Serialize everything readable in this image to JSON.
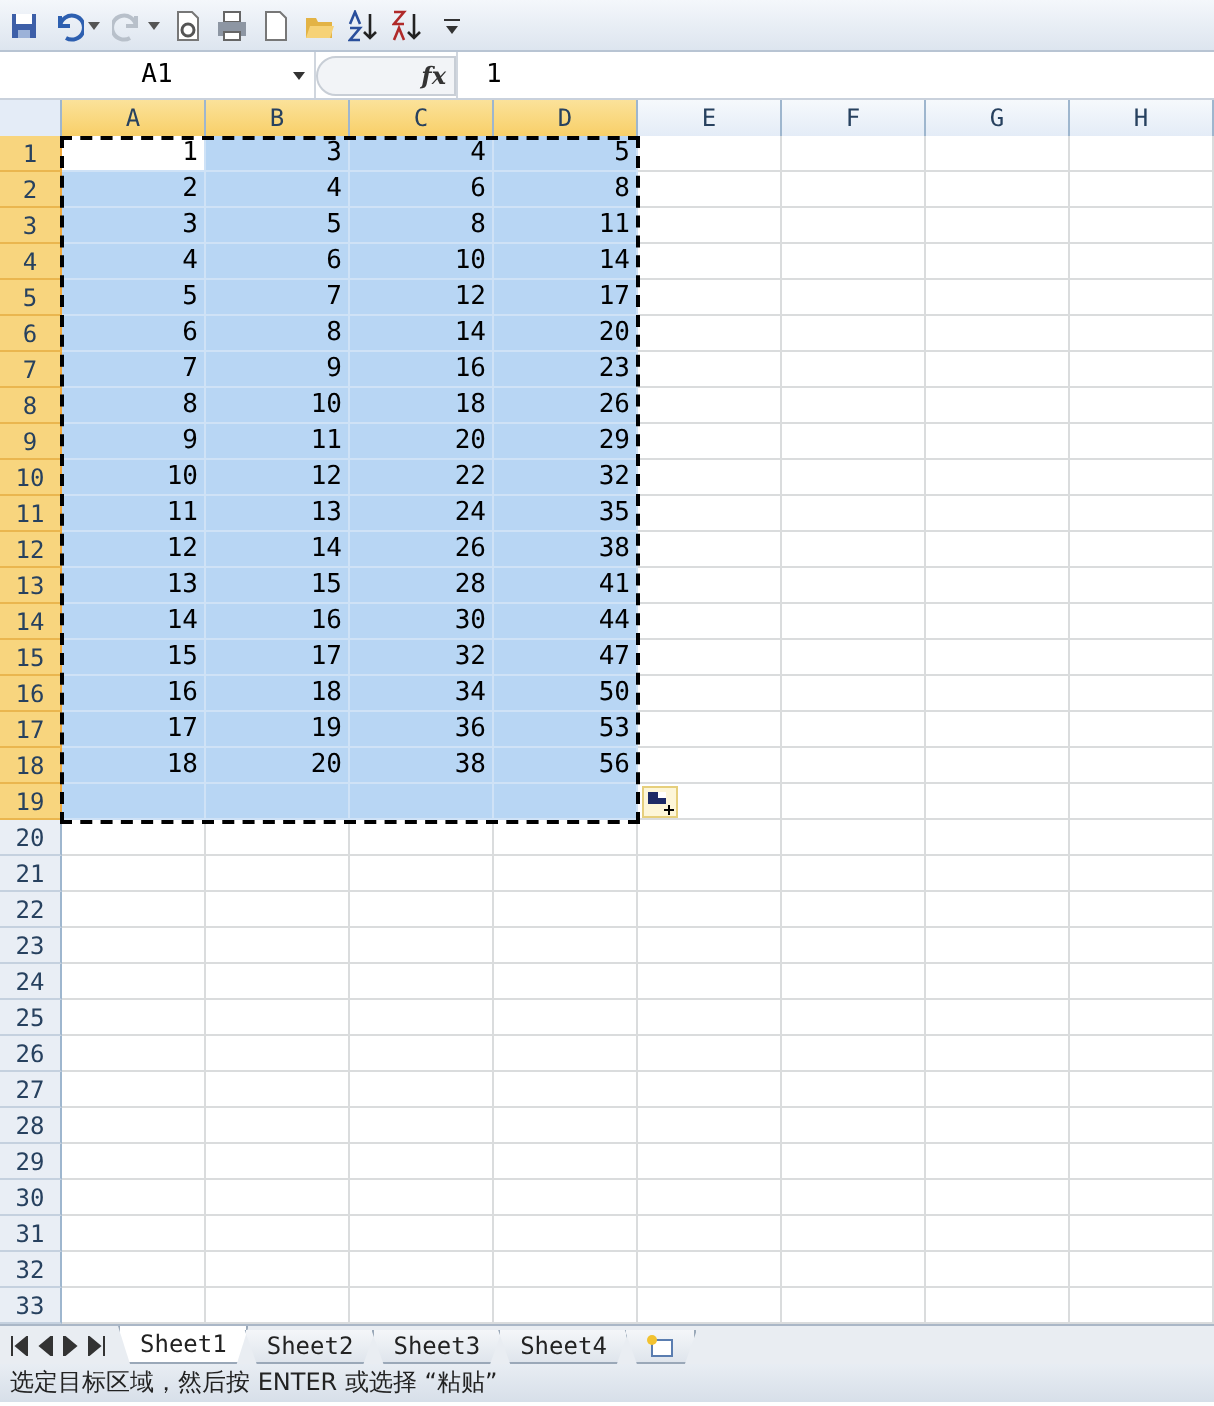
{
  "name_box": "A1",
  "formula_icon": "fx",
  "formula": "1",
  "columns": [
    {
      "label": "A",
      "selected": true
    },
    {
      "label": "B",
      "selected": true
    },
    {
      "label": "C",
      "selected": true
    },
    {
      "label": "D",
      "selected": true
    },
    {
      "label": "E",
      "selected": false
    },
    {
      "label": "F",
      "selected": false
    },
    {
      "label": "G",
      "selected": false
    },
    {
      "label": "H",
      "selected": false
    }
  ],
  "rows": [
    {
      "label": "1",
      "selected": true,
      "cells": [
        {
          "value": "1",
          "active": true
        },
        {
          "value": "3",
          "active": false
        },
        {
          "value": "4",
          "active": false
        },
        {
          "value": "5",
          "active": false
        }
      ]
    },
    {
      "label": "2",
      "selected": true,
      "cells": [
        {
          "value": "2",
          "active": false
        },
        {
          "value": "4",
          "active": false
        },
        {
          "value": "6",
          "active": false
        },
        {
          "value": "8",
          "active": false
        }
      ]
    },
    {
      "label": "3",
      "selected": true,
      "cells": [
        {
          "value": "3",
          "active": false
        },
        {
          "value": "5",
          "active": false
        },
        {
          "value": "8",
          "active": false
        },
        {
          "value": "11",
          "active": false
        }
      ]
    },
    {
      "label": "4",
      "selected": true,
      "cells": [
        {
          "value": "4",
          "active": false
        },
        {
          "value": "6",
          "active": false
        },
        {
          "value": "10",
          "active": false
        },
        {
          "value": "14",
          "active": false
        }
      ]
    },
    {
      "label": "5",
      "selected": true,
      "cells": [
        {
          "value": "5",
          "active": false
        },
        {
          "value": "7",
          "active": false
        },
        {
          "value": "12",
          "active": false
        },
        {
          "value": "17",
          "active": false
        }
      ]
    },
    {
      "label": "6",
      "selected": true,
      "cells": [
        {
          "value": "6",
          "active": false
        },
        {
          "value": "8",
          "active": false
        },
        {
          "value": "14",
          "active": false
        },
        {
          "value": "20",
          "active": false
        }
      ]
    },
    {
      "label": "7",
      "selected": true,
      "cells": [
        {
          "value": "7",
          "active": false
        },
        {
          "value": "9",
          "active": false
        },
        {
          "value": "16",
          "active": false
        },
        {
          "value": "23",
          "active": false
        }
      ]
    },
    {
      "label": "8",
      "selected": true,
      "cells": [
        {
          "value": "8",
          "active": false
        },
        {
          "value": "10",
          "active": false
        },
        {
          "value": "18",
          "active": false
        },
        {
          "value": "26",
          "active": false
        }
      ]
    },
    {
      "label": "9",
      "selected": true,
      "cells": [
        {
          "value": "9",
          "active": false
        },
        {
          "value": "11",
          "active": false
        },
        {
          "value": "20",
          "active": false
        },
        {
          "value": "29",
          "active": false
        }
      ]
    },
    {
      "label": "10",
      "selected": true,
      "cells": [
        {
          "value": "10",
          "active": false
        },
        {
          "value": "12",
          "active": false
        },
        {
          "value": "22",
          "active": false
        },
        {
          "value": "32",
          "active": false
        }
      ]
    },
    {
      "label": "11",
      "selected": true,
      "cells": [
        {
          "value": "11",
          "active": false
        },
        {
          "value": "13",
          "active": false
        },
        {
          "value": "24",
          "active": false
        },
        {
          "value": "35",
          "active": false
        }
      ]
    },
    {
      "label": "12",
      "selected": true,
      "cells": [
        {
          "value": "12",
          "active": false
        },
        {
          "value": "14",
          "active": false
        },
        {
          "value": "26",
          "active": false
        },
        {
          "value": "38",
          "active": false
        }
      ]
    },
    {
      "label": "13",
      "selected": true,
      "cells": [
        {
          "value": "13",
          "active": false
        },
        {
          "value": "15",
          "active": false
        },
        {
          "value": "28",
          "active": false
        },
        {
          "value": "41",
          "active": false
        }
      ]
    },
    {
      "label": "14",
      "selected": true,
      "cells": [
        {
          "value": "14",
          "active": false
        },
        {
          "value": "16",
          "active": false
        },
        {
          "value": "30",
          "active": false
        },
        {
          "value": "44",
          "active": false
        }
      ]
    },
    {
      "label": "15",
      "selected": true,
      "cells": [
        {
          "value": "15",
          "active": false
        },
        {
          "value": "17",
          "active": false
        },
        {
          "value": "32",
          "active": false
        },
        {
          "value": "47",
          "active": false
        }
      ]
    },
    {
      "label": "16",
      "selected": true,
      "cells": [
        {
          "value": "16",
          "active": false
        },
        {
          "value": "18",
          "active": false
        },
        {
          "value": "34",
          "active": false
        },
        {
          "value": "50",
          "active": false
        }
      ]
    },
    {
      "label": "17",
      "selected": true,
      "cells": [
        {
          "value": "17",
          "active": false
        },
        {
          "value": "19",
          "active": false
        },
        {
          "value": "36",
          "active": false
        },
        {
          "value": "53",
          "active": false
        }
      ]
    },
    {
      "label": "18",
      "selected": true,
      "cells": [
        {
          "value": "18",
          "active": false
        },
        {
          "value": "20",
          "active": false
        },
        {
          "value": "38",
          "active": false
        },
        {
          "value": "56",
          "active": false
        }
      ]
    },
    {
      "label": "19",
      "selected": true
    },
    {
      "label": "20",
      "selected": false
    },
    {
      "label": "21",
      "selected": false
    },
    {
      "label": "22",
      "selected": false
    },
    {
      "label": "23",
      "selected": false
    },
    {
      "label": "24",
      "selected": false
    },
    {
      "label": "25",
      "selected": false
    },
    {
      "label": "26",
      "selected": false
    },
    {
      "label": "27",
      "selected": false
    },
    {
      "label": "28",
      "selected": false
    },
    {
      "label": "29",
      "selected": false
    },
    {
      "label": "30",
      "selected": false
    },
    {
      "label": "31",
      "selected": false
    },
    {
      "label": "32",
      "selected": false
    },
    {
      "label": "33",
      "selected": false
    }
  ],
  "sheet_tabs": [
    {
      "label": "Sheet1",
      "selected": true
    },
    {
      "label": "Sheet2",
      "selected": false
    },
    {
      "label": "Sheet3",
      "selected": false
    },
    {
      "label": "Sheet4",
      "selected": false
    }
  ],
  "status_bar": "选定目标区域，然后按 ENTER 或选择 “粘贴”"
}
